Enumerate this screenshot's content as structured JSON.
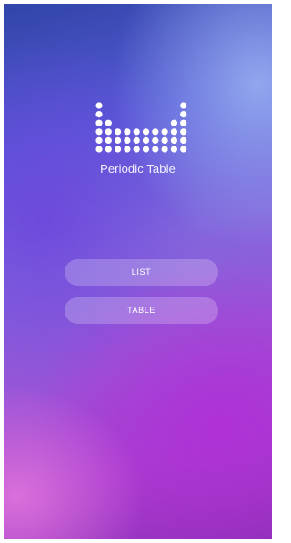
{
  "app": {
    "title": "Periodic Table",
    "logo_icon": "periodic-table-dots-icon"
  },
  "buttons": {
    "list_label": "LIST",
    "table_label": "TABLE"
  },
  "colors": {
    "gradient_top": "#2f45a8",
    "gradient_mid": "#8266dc",
    "gradient_bottom": "#a83fcf",
    "accent_pink": "#e278dc",
    "button_fill": "rgba(255,255,255,0.22)",
    "text": "#ffffff"
  }
}
